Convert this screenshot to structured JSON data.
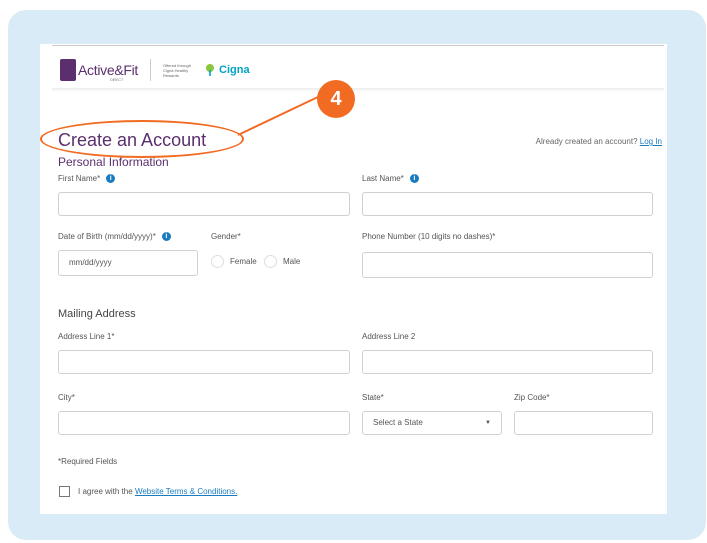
{
  "step_badge": "4",
  "header": {
    "logo_text": "Active&Fit",
    "logo_sub": "DIRECT",
    "offered_text": "Offered through Cigna Healthy Rewards",
    "partner": "Cigna"
  },
  "page": {
    "title": "Create an Account",
    "already_text": "Already created an account?",
    "login_link": "Log In"
  },
  "personal": {
    "heading": "Personal Information",
    "first_name_label": "First Name*",
    "last_name_label": "Last Name*",
    "dob_label": "Date of Birth (mm/dd/yyyy)*",
    "dob_placeholder": "mm/dd/yyyy",
    "gender_label": "Gender*",
    "gender_options": [
      "Female",
      "Male"
    ],
    "phone_label": "Phone Number (10 digits no dashes)*"
  },
  "mailing": {
    "heading": "Mailing Address",
    "address1_label": "Address Line 1*",
    "address2_label": "Address Line 2",
    "city_label": "City*",
    "state_label": "State*",
    "state_value": "Select a State",
    "zip_label": "Zip Code*"
  },
  "footer": {
    "required_note": "*Required Fields",
    "agree_text": "I agree with the",
    "terms_link": "Website Terms & Conditions."
  },
  "colors": {
    "accent": "#f26b22",
    "brand": "#5b2f6e",
    "link": "#1a7bbf",
    "background": "#d9ebf6"
  }
}
